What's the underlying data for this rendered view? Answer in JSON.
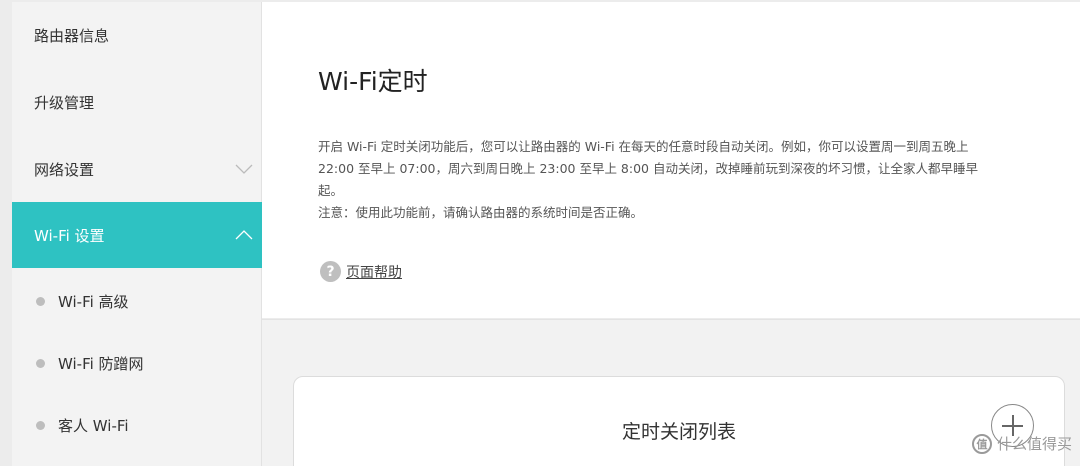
{
  "sidebar": {
    "items": [
      {
        "label": "路由器信息"
      },
      {
        "label": "升级管理"
      },
      {
        "label": "网络设置",
        "icon": "chevron-down-icon"
      },
      {
        "label": "Wi-Fi 设置",
        "icon": "chevron-up-icon",
        "active": true
      }
    ],
    "sub_items": [
      {
        "label": "Wi-Fi 高级"
      },
      {
        "label": "Wi-Fi 防蹭网"
      },
      {
        "label": "客人 Wi-Fi"
      }
    ]
  },
  "main": {
    "title": "Wi-Fi定时",
    "description_line1": "开启 Wi-Fi 定时关闭功能后，您可以让路由器的 Wi-Fi 在每天的任意时段自动关闭。例如，你可以设置周一到周五晚上",
    "description_line2": "22:00 至早上 07:00，周六到周日晚上 23:00 至早上 8:00 自动关闭，改掉睡前玩到深夜的坏习惯，让全家人都早睡早",
    "description_line3": "起。",
    "note": "注意：使用此功能前，请确认路由器的系统时间是否正确。",
    "help_icon": "?",
    "help_label": "页面帮助",
    "card_title": "定时关闭列表"
  },
  "watermark": {
    "icon_text": "值",
    "text": "什么值得买"
  },
  "colors": {
    "accent": "#2ec2c2",
    "sidebar_bg": "#f3f3f3"
  }
}
